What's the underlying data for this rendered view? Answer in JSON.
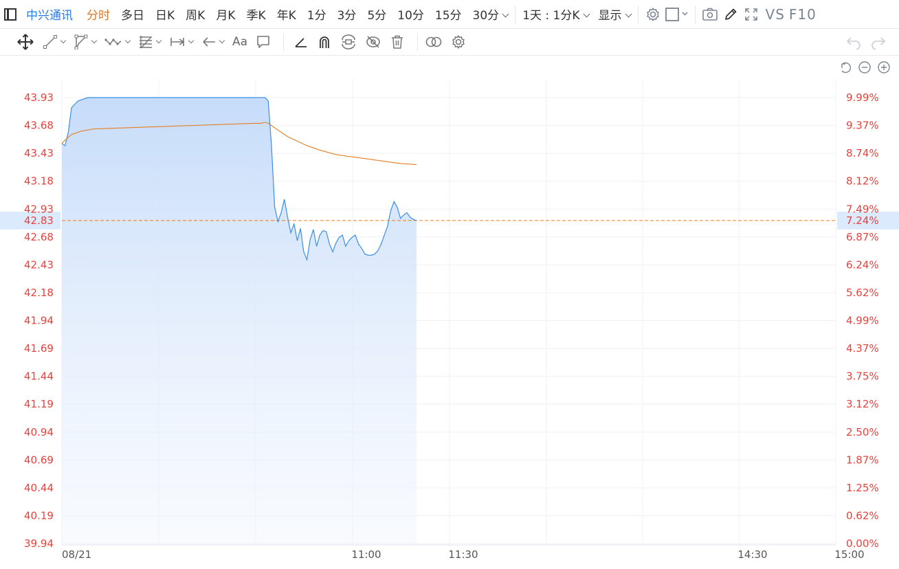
{
  "topbar": {
    "stock_name": "中兴通讯",
    "periods": [
      "分时",
      "多日",
      "日K",
      "周K",
      "月K",
      "季K",
      "年K",
      "1分",
      "3分",
      "5分",
      "10分",
      "15分",
      "30分"
    ],
    "active_period": "分时",
    "combo_label": "1天 : 1分K",
    "display_label": "显示",
    "vs_label": "VS",
    "f10_label": "F10"
  },
  "toolbar": {
    "text_tool_label": "Aa"
  },
  "colors": {
    "price_line": "#3a8ee6",
    "avg_line": "#e67e22",
    "area_fill": "#cfe2fb",
    "axis_red": "#e8413c",
    "active_tab": "#e8731a",
    "current_price_bg": "#dbeafc"
  },
  "chart_data": {
    "type": "line",
    "title": "",
    "xlabel": "",
    "ylabel": "",
    "date": "08/21",
    "x_ticks": [
      "08/21",
      "11:00",
      "11:30",
      "14:30",
      "15:00"
    ],
    "y_ticks_price": [
      "43.93",
      "43.68",
      "43.43",
      "43.18",
      "42.93",
      "42.68",
      "42.43",
      "42.18",
      "41.94",
      "41.69",
      "41.44",
      "41.19",
      "40.94",
      "40.69",
      "40.44",
      "40.19",
      "39.94"
    ],
    "y_ticks_pct": [
      "9.99%",
      "9.37%",
      "8.74%",
      "8.12%",
      "7.49%",
      "6.87%",
      "6.24%",
      "5.62%",
      "4.99%",
      "4.37%",
      "3.75%",
      "3.12%",
      "2.50%",
      "1.87%",
      "1.25%",
      "0.62%",
      "0.00%"
    ],
    "ylim": [
      39.94,
      43.93
    ],
    "current_price": "42.83",
    "current_pct": "7.24%",
    "current_value": 42.83,
    "session_minutes": 240,
    "series": [
      {
        "kind": "price",
        "x": [
          0,
          1,
          2,
          3,
          5,
          8,
          12,
          16,
          20,
          25,
          30,
          35,
          40,
          45,
          50,
          55,
          60,
          63,
          64,
          65,
          66,
          67,
          68,
          69,
          70,
          71,
          72,
          73,
          74,
          75,
          76,
          77,
          78,
          79,
          80,
          81,
          82,
          83,
          84,
          85,
          86,
          87,
          88,
          89,
          90,
          91,
          92,
          93,
          94,
          95,
          96,
          97,
          98,
          99,
          100,
          101,
          102,
          103,
          104,
          105,
          106,
          107,
          108,
          109,
          110
        ],
        "values": [
          43.52,
          43.5,
          43.62,
          43.84,
          43.9,
          43.93,
          43.93,
          43.93,
          43.93,
          43.93,
          43.93,
          43.93,
          43.93,
          43.93,
          43.93,
          43.93,
          43.93,
          43.93,
          43.9,
          43.5,
          42.95,
          42.82,
          42.9,
          43.02,
          42.86,
          42.72,
          42.8,
          42.65,
          42.76,
          42.55,
          42.48,
          42.66,
          42.75,
          42.6,
          42.7,
          42.74,
          42.73,
          42.62,
          42.55,
          42.63,
          42.68,
          42.7,
          42.6,
          42.65,
          42.68,
          42.7,
          42.62,
          42.58,
          42.53,
          42.52,
          42.52,
          42.53,
          42.56,
          42.62,
          42.7,
          42.78,
          42.92,
          43.0,
          42.95,
          42.85,
          42.88,
          42.9,
          42.86,
          42.84,
          42.83
        ]
      },
      {
        "kind": "average",
        "x": [
          0,
          1,
          3,
          6,
          10,
          20,
          30,
          40,
          50,
          60,
          62,
          63,
          64,
          66,
          68,
          70,
          73,
          76,
          80,
          85,
          90,
          95,
          100,
          105,
          110
        ],
        "values": [
          43.52,
          43.55,
          43.6,
          43.63,
          43.65,
          43.66,
          43.67,
          43.68,
          43.69,
          43.7,
          43.7,
          43.71,
          43.7,
          43.66,
          43.62,
          43.58,
          43.54,
          43.5,
          43.46,
          43.42,
          43.4,
          43.38,
          43.36,
          43.34,
          43.33
        ]
      }
    ]
  }
}
